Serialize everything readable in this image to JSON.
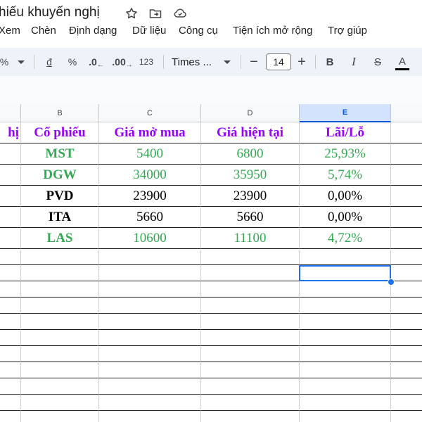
{
  "document": {
    "title": "hiếu khuyến nghị"
  },
  "menu": [
    "Xem",
    "Chèn",
    "Định dạng",
    "Dữ liệu",
    "Công cụ",
    "Tiện ích mở rộng",
    "Trợ giúp"
  ],
  "toolbar": {
    "percent_label": "%",
    "currency_label": "đ",
    "percent_format_label": "%",
    "decrease_decimal_label": ".0",
    "increase_decimal_label": ".00",
    "number_format_label": "123",
    "font_name": "Times ...",
    "font_size": "14",
    "minus_label": "−",
    "plus_label": "+",
    "bold_label": "B",
    "italic_label": "I",
    "strike_label": "S",
    "text_color_label": "A"
  },
  "columns": [
    "B",
    "C",
    "D",
    "E"
  ],
  "selected_column": "E",
  "table": {
    "partial_header": "hị",
    "headers": [
      "Cổ phiếu",
      "Giá mở mua",
      "Giá hiện tại",
      "Lãi/Lỗ"
    ],
    "rows": [
      {
        "ticker": "MST",
        "open": "5400",
        "current": "6800",
        "pl": "25,93%",
        "color": "green"
      },
      {
        "ticker": "DGW",
        "open": "34000",
        "current": "35950",
        "pl": "5,74%",
        "color": "green"
      },
      {
        "ticker": "PVD",
        "open": "23900",
        "current": "23900",
        "pl": "0,00%",
        "color": "black"
      },
      {
        "ticker": "ITA",
        "open": "5660",
        "current": "5660",
        "pl": "0,00%",
        "color": "black"
      },
      {
        "ticker": "LAS",
        "open": "10600",
        "current": "11100",
        "pl": "4,72%",
        "color": "green"
      }
    ]
  },
  "colors": {
    "header_purple": "#9900ff",
    "gain_green": "#34a853",
    "selection_blue": "#1a73e8"
  }
}
